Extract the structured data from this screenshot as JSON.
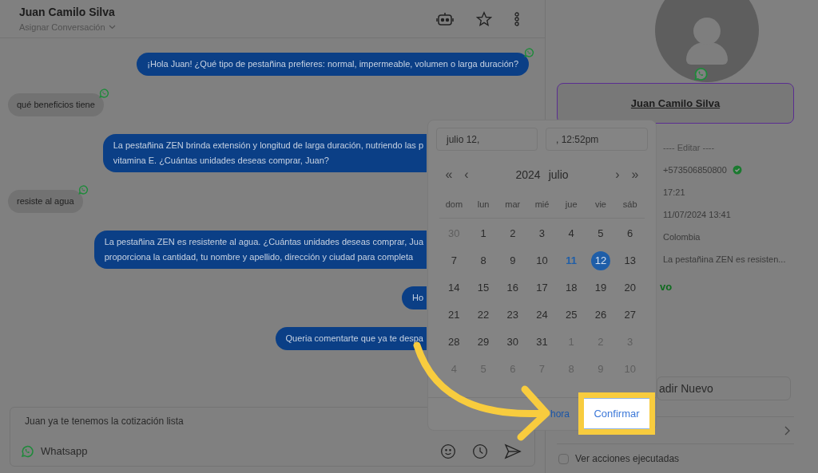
{
  "header": {
    "contact_name": "Juan Camilo Silva",
    "assign_label": "Asignar Conversación"
  },
  "messages": [
    {
      "kind": "outgoing",
      "clipped": false,
      "whatsapp": true,
      "lines": [
        "¡Hola Juan! ¿Qué tipo de pestañina prefieres: normal, impermeable, volumen o larga duración?"
      ]
    },
    {
      "kind": "incoming",
      "clipped": false,
      "whatsapp": true,
      "lines": [
        "qué beneficios tiene"
      ]
    },
    {
      "kind": "outgoing",
      "clipped": true,
      "whatsapp": false,
      "lines": [
        "La pestañina ZEN brinda extensión y longitud de larga duración, nutriendo las p",
        "vitamina E. ¿Cuántas unidades deseas comprar, Juan?"
      ]
    },
    {
      "kind": "incoming",
      "clipped": false,
      "whatsapp": true,
      "lines": [
        "resiste al agua"
      ]
    },
    {
      "kind": "outgoing",
      "clipped": true,
      "whatsapp": false,
      "lines": [
        "La pestañina ZEN es resistente al agua. ¿Cuántas unidades deseas comprar, Jua",
        "proporciona la cantidad, tu nombre y apellido, dirección y ciudad para completa"
      ]
    },
    {
      "kind": "outgoing",
      "clipped": true,
      "whatsapp": false,
      "lines": [
        "Ho"
      ]
    },
    {
      "kind": "outgoing",
      "clipped": true,
      "whatsapp": false,
      "lines": [
        "Queria comentarte que ya te despa"
      ]
    }
  ],
  "composer": {
    "value": "Juan ya te tenemos la cotización lista",
    "channel": "Whatsapp"
  },
  "contact": {
    "name": "Juan Camilo Silva",
    "edit_label": "---- Editar ----",
    "fields": [
      {
        "kind": "phone",
        "value": "+573506850800",
        "verified": true
      },
      {
        "kind": "text",
        "value": "17:21",
        "verified": false
      },
      {
        "kind": "text",
        "value": "11/07/2024 13:41",
        "verified": false
      },
      {
        "kind": "text",
        "value": "Colombia",
        "verified": false
      },
      {
        "kind": "text",
        "value": "La pestañina ZEN es resisten...",
        "verified": false
      },
      {
        "kind": "status",
        "value": "vo",
        "verified": false
      }
    ],
    "add_button": "adir Nuevo",
    "show_actions": {
      "label": "Ver acciones ejecutadas",
      "checked": false
    }
  },
  "date_picker": {
    "date_value": "julio 12,",
    "time_value": ", 12:52pm",
    "prev_year": "«",
    "prev_month": "‹",
    "year": "2024",
    "month": "julio",
    "next_month": "›",
    "next_year": "»",
    "weekdays": [
      "dom",
      "lun",
      "mar",
      "mié",
      "jue",
      "vie",
      "sáb"
    ],
    "days": [
      {
        "label": "30",
        "outside": true,
        "today": false,
        "selected": false
      },
      {
        "label": "1",
        "outside": false,
        "today": false,
        "selected": false
      },
      {
        "label": "2",
        "outside": false,
        "today": false,
        "selected": false
      },
      {
        "label": "3",
        "outside": false,
        "today": false,
        "selected": false
      },
      {
        "label": "4",
        "outside": false,
        "today": false,
        "selected": false
      },
      {
        "label": "5",
        "outside": false,
        "today": false,
        "selected": false
      },
      {
        "label": "6",
        "outside": false,
        "today": false,
        "selected": false
      },
      {
        "label": "7",
        "outside": false,
        "today": false,
        "selected": false
      },
      {
        "label": "8",
        "outside": false,
        "today": false,
        "selected": false
      },
      {
        "label": "9",
        "outside": false,
        "today": false,
        "selected": false
      },
      {
        "label": "10",
        "outside": false,
        "today": false,
        "selected": false
      },
      {
        "label": "11",
        "outside": false,
        "today": true,
        "selected": false
      },
      {
        "label": "12",
        "outside": false,
        "today": false,
        "selected": true
      },
      {
        "label": "13",
        "outside": false,
        "today": false,
        "selected": false
      },
      {
        "label": "14",
        "outside": false,
        "today": false,
        "selected": false
      },
      {
        "label": "15",
        "outside": false,
        "today": false,
        "selected": false
      },
      {
        "label": "16",
        "outside": false,
        "today": false,
        "selected": false
      },
      {
        "label": "17",
        "outside": false,
        "today": false,
        "selected": false
      },
      {
        "label": "18",
        "outside": false,
        "today": false,
        "selected": false
      },
      {
        "label": "19",
        "outside": false,
        "today": false,
        "selected": false
      },
      {
        "label": "20",
        "outside": false,
        "today": false,
        "selected": false
      },
      {
        "label": "21",
        "outside": false,
        "today": false,
        "selected": false
      },
      {
        "label": "22",
        "outside": false,
        "today": false,
        "selected": false
      },
      {
        "label": "23",
        "outside": false,
        "today": false,
        "selected": false
      },
      {
        "label": "24",
        "outside": false,
        "today": false,
        "selected": false
      },
      {
        "label": "25",
        "outside": false,
        "today": false,
        "selected": false
      },
      {
        "label": "26",
        "outside": false,
        "today": false,
        "selected": false
      },
      {
        "label": "27",
        "outside": false,
        "today": false,
        "selected": false
      },
      {
        "label": "28",
        "outside": false,
        "today": false,
        "selected": false
      },
      {
        "label": "29",
        "outside": false,
        "today": false,
        "selected": false
      },
      {
        "label": "30",
        "outside": false,
        "today": false,
        "selected": false
      },
      {
        "label": "31",
        "outside": false,
        "today": false,
        "selected": false
      },
      {
        "label": "1",
        "outside": true,
        "today": false,
        "selected": false
      },
      {
        "label": "2",
        "outside": true,
        "today": false,
        "selected": false
      },
      {
        "label": "3",
        "outside": true,
        "today": false,
        "selected": false
      },
      {
        "label": "4",
        "outside": true,
        "today": false,
        "selected": false
      },
      {
        "label": "5",
        "outside": true,
        "today": false,
        "selected": false
      },
      {
        "label": "6",
        "outside": true,
        "today": false,
        "selected": false
      },
      {
        "label": "7",
        "outside": true,
        "today": false,
        "selected": false
      },
      {
        "label": "8",
        "outside": true,
        "today": false,
        "selected": false
      },
      {
        "label": "9",
        "outside": true,
        "today": false,
        "selected": false
      },
      {
        "label": "10",
        "outside": true,
        "today": false,
        "selected": false
      }
    ],
    "now_link": "hora",
    "confirm_button": "Confirmar"
  }
}
